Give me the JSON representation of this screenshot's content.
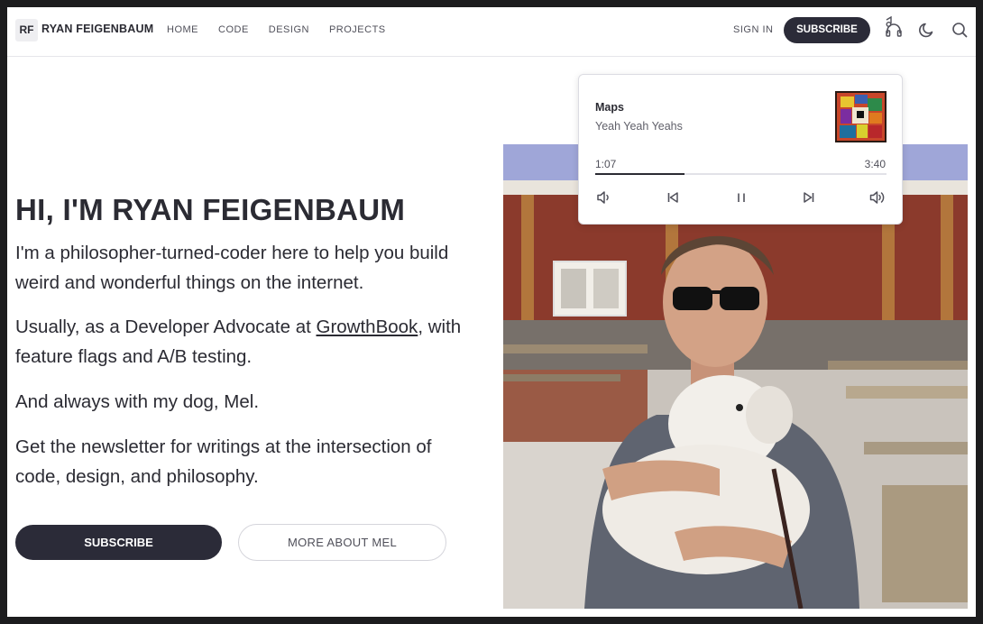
{
  "header": {
    "logo_initials": "RF",
    "site_name": "RYAN FEIGENBAUM",
    "nav": [
      "HOME",
      "CODE",
      "DESIGN",
      "PROJECTS"
    ],
    "sign_in": "SIGN IN",
    "subscribe": "SUBSCRIBE",
    "icons": [
      "music-player-icon",
      "dark-mode-moon-icon",
      "search-icon"
    ]
  },
  "hero": {
    "title": "HI, I'M RYAN FEIGENBAUM",
    "p1": "I'm a philosopher-turned-coder here to help you build weird and wonderful things on the internet.",
    "p2_before": "Usually, as a Developer Advocate at ",
    "p2_link": "GrowthBook",
    "p2_after": ", with feature flags and A/B testing.",
    "p3": "And always with my dog, Mel.",
    "p4": "Get the newsletter for writings at the intersection of code, design, and philosophy.",
    "subscribe_button": "SUBSCRIBE",
    "more_button": "MORE ABOUT MEL"
  },
  "player": {
    "track": "Maps",
    "artist": "Yeah Yeah Yeahs",
    "current_time": "1:07",
    "total_time": "3:40",
    "progress": 0.305,
    "controls": [
      "volume-down-icon",
      "previous-track-icon",
      "pause-icon",
      "next-track-icon",
      "volume-up-icon"
    ]
  },
  "colors": {
    "accent_dark": "#2b2b38",
    "text": "#2b2b33",
    "page_bg": "#ffffff",
    "outer_bg": "#1c1c1e"
  }
}
